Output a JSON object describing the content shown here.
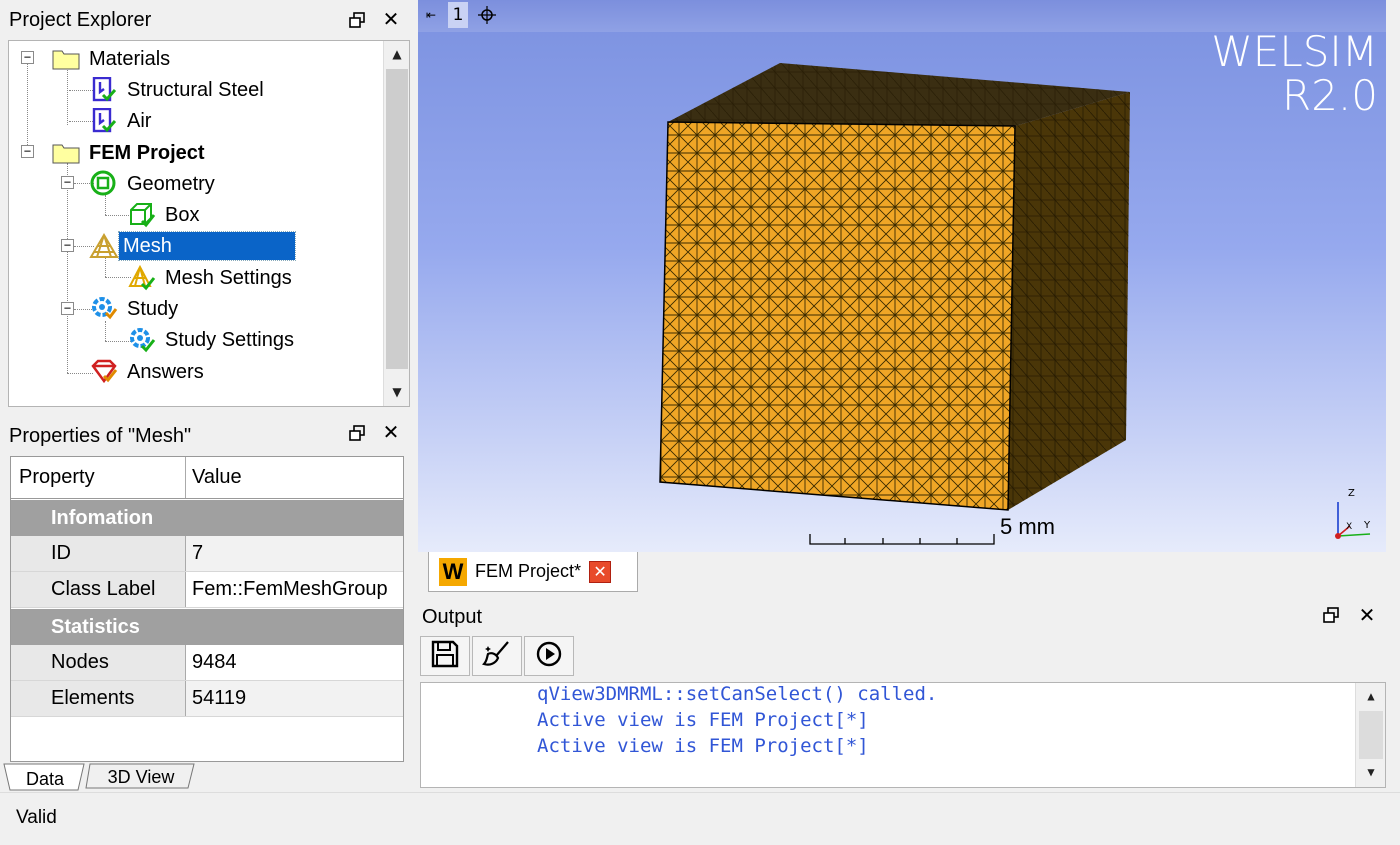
{
  "project_explorer": {
    "title": "Project Explorer",
    "tree": [
      {
        "label": "Materials",
        "icon": "folder-icon",
        "bold": false
      },
      {
        "label": "Structural Steel",
        "icon": "material-icon"
      },
      {
        "label": "Air",
        "icon": "material-icon"
      },
      {
        "label": "FEM Project",
        "icon": "folder-icon",
        "bold": true
      },
      {
        "label": "Geometry",
        "icon": "geometry-icon"
      },
      {
        "label": "Box",
        "icon": "box-icon"
      },
      {
        "label": "Mesh",
        "icon": "mesh-icon",
        "selected": true
      },
      {
        "label": "Mesh Settings",
        "icon": "mesh-settings-icon"
      },
      {
        "label": "Study",
        "icon": "study-icon"
      },
      {
        "label": "Study Settings",
        "icon": "gear-icon"
      },
      {
        "label": "Answers",
        "icon": "answers-icon"
      }
    ]
  },
  "properties": {
    "title": "Properties of \"Mesh\"",
    "header": {
      "property": "Property",
      "value": "Value"
    },
    "groups": [
      {
        "name": "Infomation",
        "items": [
          {
            "property": "ID",
            "value": "7"
          },
          {
            "property": "Class Label",
            "value": "Fem::FemMeshGroup"
          }
        ]
      },
      {
        "name": "Statistics",
        "items": [
          {
            "property": "Nodes",
            "value": "9484"
          },
          {
            "property": "Elements",
            "value": "54119"
          }
        ]
      }
    ]
  },
  "bottom_tabs": [
    "Data",
    "3D View"
  ],
  "view3d": {
    "toolbar_number": "1",
    "watermark_line1": "WELSIM",
    "watermark_line2": "R2.0",
    "scale_label": "5 mm",
    "mesh_color": "#f5a623",
    "axes": {
      "x": "X",
      "y": "Y",
      "z": "Z"
    }
  },
  "doc_tab": {
    "label": "FEM Project*",
    "app_icon_letter": "W"
  },
  "output": {
    "title": "Output",
    "lines": [
      "qView3DMRML::setCanSelect() called.",
      "Active view is FEM Project[*]",
      "Active view is FEM Project[*]"
    ]
  },
  "status": {
    "text": "Valid"
  },
  "colors": {
    "selection": "#0a64c8",
    "output_text": "#3156d6"
  }
}
